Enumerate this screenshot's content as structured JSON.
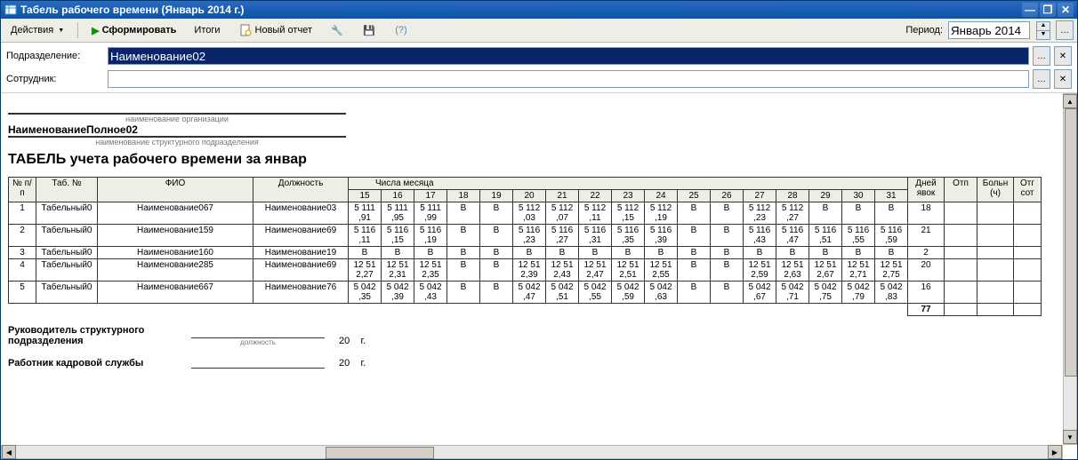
{
  "window": {
    "title": "Табель рабочего времени (Январь 2014 г.)"
  },
  "toolbar": {
    "actions": "Действия",
    "generate": "Сформировать",
    "totals": "Итоги",
    "new_report": "Новый отчет",
    "period_label": "Период:",
    "period_value": "Январь 2014"
  },
  "filters": {
    "department_label": "Подразделение:",
    "department_value": "Наименование02",
    "employee_label": "Сотрудник:",
    "employee_value": ""
  },
  "report": {
    "org_label": "наименование организации",
    "org_name": "НаименованиеПолное02",
    "dept_label": "наименование структурного подразделения",
    "title": "ТАБЕЛЬ учета рабочего времени за январ",
    "head": {
      "np": "№ п/п",
      "tabno": "Таб. №",
      "fio": "ФИО",
      "position": "Должность",
      "days_header": "Числа месяца",
      "days": [
        "15",
        "16",
        "17",
        "18",
        "19",
        "20",
        "21",
        "22",
        "23",
        "24",
        "25",
        "26",
        "27",
        "28",
        "29",
        "30",
        "31"
      ],
      "attend": "Дней явок",
      "vac": "Отп",
      "sick": "Больн (ч)",
      "miss": "Отг сот"
    },
    "rows": [
      {
        "n": "1",
        "tab": "Табельный0",
        "fio": "Наименование067",
        "pos": "Наименование03",
        "cells": [
          "5 111 ,91",
          "5 111 ,95",
          "5 111 ,99",
          "В",
          "В",
          "5 112 ,03",
          "5 112 ,07",
          "5 112 ,11",
          "5 112 ,15",
          "5 112 ,19",
          "В",
          "В",
          "5 112 ,23",
          "5 112 ,27",
          "В",
          "В",
          "В"
        ],
        "att": "18"
      },
      {
        "n": "2",
        "tab": "Табельный0",
        "fio": "Наименование159",
        "pos": "Наименование69",
        "cells": [
          "5 116 ,11",
          "5 116 ,15",
          "5 116 ,19",
          "В",
          "В",
          "5 116 ,23",
          "5 116 ,27",
          "5 116 ,31",
          "5 116 ,35",
          "5 116 ,39",
          "В",
          "В",
          "5 116 ,43",
          "5 116 ,47",
          "5 116 ,51",
          "5 116 ,55",
          "5 116 ,59"
        ],
        "att": "21"
      },
      {
        "n": "3",
        "tab": "Табельный0",
        "fio": "Наименование160",
        "pos": "Наименование19",
        "cells": [
          "В",
          "В",
          "В",
          "В",
          "В",
          "В",
          "В",
          "В",
          "В",
          "В",
          "В",
          "В",
          "В",
          "В",
          "В",
          "В",
          "В"
        ],
        "att": "2"
      },
      {
        "n": "4",
        "tab": "Табельный0",
        "fio": "Наименование285",
        "pos": "Наименование69",
        "cells": [
          "12 51 2,27",
          "12 51 2,31",
          "12 51 2,35",
          "В",
          "В",
          "12 51 2,39",
          "12 51 2,43",
          "12 51 2,47",
          "12 51 2,51",
          "12 51 2,55",
          "В",
          "В",
          "12 51 2,59",
          "12 51 2,63",
          "12 51 2,67",
          "12 51 2,71",
          "12 51 2,75"
        ],
        "att": "20"
      },
      {
        "n": "5",
        "tab": "Табельный0",
        "fio": "Наименование667",
        "pos": "Наименование76",
        "cells": [
          "5 042 ,35",
          "5 042 ,39",
          "5 042 ,43",
          "В",
          "В",
          "5 042 ,47",
          "5 042 ,51",
          "5 042 ,55",
          "5 042 ,59",
          "5 042 ,63",
          "В",
          "В",
          "5 042 ,67",
          "5 042 ,71",
          "5 042 ,75",
          "5 042 ,79",
          "5 042 ,83"
        ],
        "att": "16"
      }
    ],
    "total_att": "77",
    "sign": {
      "head": "Руководитель структурного подразделения",
      "position": "должность",
      "year": "20",
      "g": "г.",
      "hr": "Работник кадровой службы"
    }
  }
}
